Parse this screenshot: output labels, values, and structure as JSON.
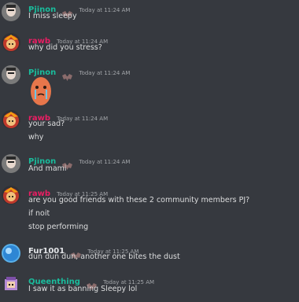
{
  "messages": [
    {
      "user": "Pjinon",
      "user_color": "#1abc9c",
      "badge": "bat-emoji",
      "time": "Today at 11:24 AM",
      "lines": [
        "I miss sleepy"
      ],
      "avatar": "man-face"
    },
    {
      "user": "rawb",
      "user_color": "#e91e63",
      "time": "Today at 11:24 AM",
      "lines": [
        "why did you stress?"
      ],
      "avatar": "cartoon-character"
    },
    {
      "user": "Pjinon",
      "user_color": "#1abc9c",
      "badge": "bat-emoji",
      "time": "Today at 11:24 AM",
      "lines": [],
      "sticker": "crying-potato-sticker",
      "avatar": "man-face"
    },
    {
      "user": "rawb",
      "user_color": "#e91e63",
      "time": "Today at 11:24 AM",
      "lines": [
        "your sad?",
        "why"
      ],
      "avatar": "cartoon-character"
    },
    {
      "user": "Pjinon",
      "user_color": "#1abc9c",
      "badge": "bat-emoji",
      "time": "Today at 11:24 AM",
      "lines": [
        "And mami"
      ],
      "avatar": "man-face"
    },
    {
      "user": "rawb",
      "user_color": "#e91e63",
      "time": "Today at 11:25 AM",
      "lines": [
        "are you good friends with these 2 community members PJ?",
        "if noit",
        "stop performing"
      ],
      "avatar": "cartoon-character"
    },
    {
      "user": "Fur1001",
      "user_color": "#e3e5e8",
      "badge": "bat-emoji",
      "time": "Today at 11:25 AM",
      "lines": [
        "dun dun dun, another one bites the dust"
      ],
      "avatar": "blue-orb"
    },
    {
      "user": "Queenthing",
      "user_color": "#1abc9c",
      "badge": "bat-emoji",
      "time": "Today at 11:25 AM",
      "lines": [
        "I saw it as banning Sleepy lol"
      ],
      "avatar": "pixel-character"
    }
  ],
  "colors": {
    "background": "#36393f",
    "text": "#dcddde",
    "timestamp": "#a3a6aa"
  }
}
